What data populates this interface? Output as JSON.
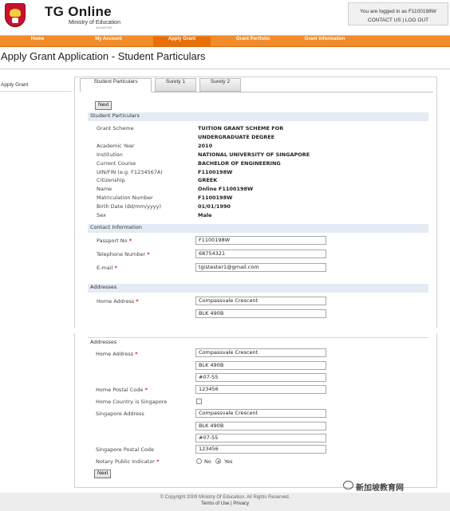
{
  "header": {
    "app_title": "TG Online",
    "ministry": "Ministry of Education",
    "ministry_sub": "SINGAPORE",
    "login_text": "You are logged in as F1100198W",
    "contact_label": "CONTACT US",
    "separator": "|",
    "logout_label": "LOG OUT"
  },
  "nav": {
    "items": [
      {
        "label": "Home"
      },
      {
        "label": "My Account"
      },
      {
        "label": "Apply Grant"
      },
      {
        "label": "Grant Portfolio"
      },
      {
        "label": "Grant Information"
      }
    ],
    "active": "Apply Grant"
  },
  "page": {
    "title": "Apply Grant Application - Student Particulars",
    "side_label": "Apply Grant"
  },
  "tabs": [
    {
      "label": "Student Particulars"
    },
    {
      "label": "Surety 1"
    },
    {
      "label": "Surety 2"
    }
  ],
  "buttons": {
    "next": "Next"
  },
  "student": {
    "section_title": "Student Particulars",
    "fields": [
      {
        "label": "Grant Scheme",
        "value": "TUITION GRANT SCHEME FOR"
      },
      {
        "label": "",
        "value": "UNDERGRADUATE DEGREE"
      },
      {
        "label": "Academic Year",
        "value": "2010"
      },
      {
        "label": "Institution",
        "value": "NATIONAL UNIVERSITY OF SINGAPORE"
      },
      {
        "label": "Current Course",
        "value": "BACHELOR OF ENGINEERING"
      },
      {
        "label": "UIN/FIN (e.g. F1234567A)",
        "value": "F1100198W"
      },
      {
        "label": "Citizenship",
        "value": "GREEK"
      },
      {
        "label": "Name",
        "value": "Online F1100198W"
      },
      {
        "label": "Matriculation Number",
        "value": "F1100198W"
      },
      {
        "label": "Birth Date (dd/mm/yyyy)",
        "value": "01/01/1990"
      },
      {
        "label": "Sex",
        "value": "Male"
      }
    ]
  },
  "contact": {
    "section_title": "Contact Information",
    "passport_label": "Passport No",
    "passport_value": "F1100198W",
    "telephone_label": "Telephone Number",
    "telephone_value": "68754321",
    "email_label": "E-mail",
    "email_value": "tgistester1@gmail.com",
    "required_mark": "*"
  },
  "addresses_top": {
    "section_title": "Addresses",
    "home_label": "Home Address",
    "line1": "Compassvale Crescent",
    "line2": "BLK 490B"
  },
  "addresses": {
    "section_title": "Addresses",
    "home_label": "Home Address",
    "home_line1": "Compassvale Crescent",
    "home_line2": "BLK 490B",
    "home_line3": "#07-55",
    "home_postal_label": "Home Postal Code",
    "home_postal_value": "123456",
    "home_country_label": "Home Country is Singapore",
    "sg_label": "Singapore Address",
    "sg_line1": "Compassvale Crescent",
    "sg_line2": "BLK 490B",
    "sg_line3": "#07-55",
    "sg_postal_label": "Singapore Postal Code",
    "sg_postal_value": "123456",
    "notary_label": "Notary Public Indicator",
    "no_label": "No",
    "yes_label": "Yes",
    "notary_selected": "Yes"
  },
  "footer": {
    "copyright": "© Copyright 2009 Ministry Of Education. All Rights Reserved.",
    "terms_label": "Terms of Use",
    "separator": "|",
    "privacy_label": "Privacy"
  },
  "watermark": {
    "text": "新加坡教育网"
  },
  "colors": {
    "nav": "#f28c2a",
    "nav_active": "#e86f0a",
    "section_bg": "#e4ebf5",
    "required": "#dd1111"
  }
}
